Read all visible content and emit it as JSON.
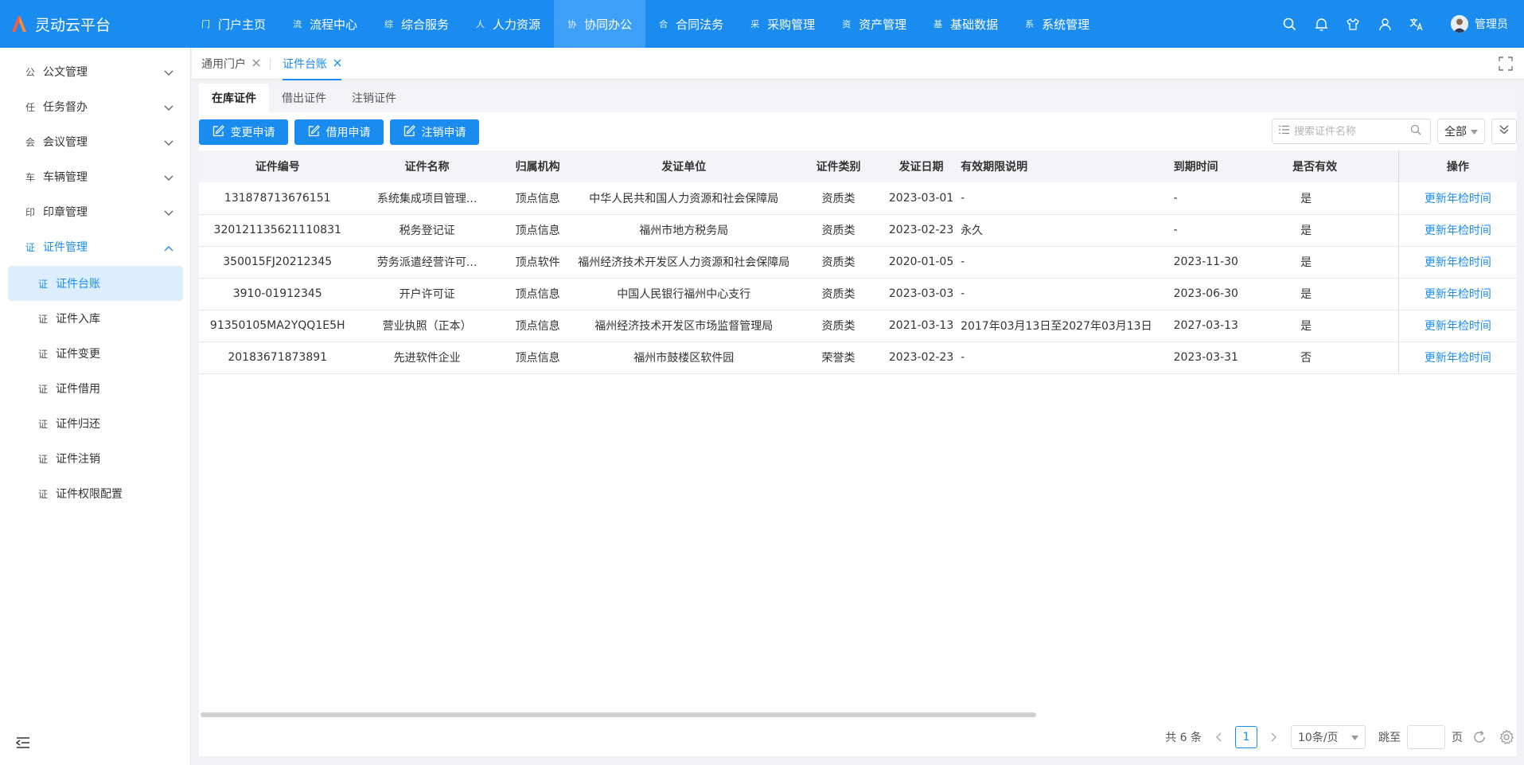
{
  "app": {
    "title": "灵动云平台"
  },
  "nav": [
    {
      "icon": "门",
      "label": "门户主页"
    },
    {
      "icon": "流",
      "label": "流程中心"
    },
    {
      "icon": "综",
      "label": "综合服务"
    },
    {
      "icon": "人",
      "label": "人力资源"
    },
    {
      "icon": "协",
      "label": "协同办公",
      "active": true
    },
    {
      "icon": "合",
      "label": "合同法务"
    },
    {
      "icon": "采",
      "label": "采购管理"
    },
    {
      "icon": "资",
      "label": "资产管理"
    },
    {
      "icon": "基",
      "label": "基础数据"
    },
    {
      "icon": "系",
      "label": "系统管理"
    }
  ],
  "user": {
    "name": "管理员"
  },
  "sidebar": {
    "groups": [
      {
        "icon": "公",
        "label": "公文管理"
      },
      {
        "icon": "任",
        "label": "任务督办"
      },
      {
        "icon": "会",
        "label": "会议管理"
      },
      {
        "icon": "车",
        "label": "车辆管理"
      },
      {
        "icon": "印",
        "label": "印章管理"
      },
      {
        "icon": "证",
        "label": "证件管理",
        "open": true
      }
    ],
    "sub_items": [
      {
        "icon": "证",
        "label": "证件台账",
        "active": true
      },
      {
        "icon": "证",
        "label": "证件入库"
      },
      {
        "icon": "证",
        "label": "证件变更"
      },
      {
        "icon": "证",
        "label": "证件借用"
      },
      {
        "icon": "证",
        "label": "证件归还"
      },
      {
        "icon": "证",
        "label": "证件注销"
      },
      {
        "icon": "证",
        "label": "证件权限配置"
      }
    ]
  },
  "page_tabs": [
    {
      "label": "通用门户"
    },
    {
      "label": "证件台账",
      "active": true
    }
  ],
  "sub_tabs": [
    {
      "label": "在库证件",
      "active": true
    },
    {
      "label": "借出证件"
    },
    {
      "label": "注销证件"
    }
  ],
  "actions": [
    {
      "label": "变更申请"
    },
    {
      "label": "借用申请"
    },
    {
      "label": "注销申请"
    }
  ],
  "search": {
    "placeholder": "搜索证件名称"
  },
  "filter": {
    "value": "全部"
  },
  "table": {
    "columns": [
      "证件编号",
      "证件名称",
      "归属机构",
      "发证单位",
      "证件类别",
      "发证日期",
      "有效期限说明",
      "到期时间",
      "是否有效",
      "操作"
    ],
    "rows": [
      [
        "131878713676151",
        "系统集成项目管理...",
        "顶点信息",
        "中华人民共和国人力资源和社会保障局",
        "资质类",
        "2023-03-01",
        "-",
        "-",
        "是",
        "更新年检时间"
      ],
      [
        "320121135621110831",
        "税务登记证",
        "顶点信息",
        "福州市地方税务局",
        "资质类",
        "2023-02-23",
        "永久",
        "-",
        "是",
        "更新年检时间"
      ],
      [
        "350015FJ20212345",
        "劳务派遣经营许可...",
        "顶点软件",
        "福州经济技术开发区人力资源和社会保障局",
        "资质类",
        "2020-01-05",
        "-",
        "2023-11-30",
        "是",
        "更新年检时间"
      ],
      [
        "3910-01912345",
        "开户许可证",
        "顶点信息",
        "中国人民银行福州中心支行",
        "资质类",
        "2023-03-03",
        "-",
        "2023-06-30",
        "是",
        "更新年检时间"
      ],
      [
        "91350105MA2YQQ1E5H",
        "营业执照（正本）",
        "顶点信息",
        "福州经济技术开发区市场监督管理局",
        "资质类",
        "2021-03-13",
        "2017年03月13日至2027年03月13日",
        "2027-03-13",
        "是",
        "更新年检时间"
      ],
      [
        "20183671873891",
        "先进软件企业",
        "顶点信息",
        "福州市鼓楼区软件园",
        "荣誉类",
        "2023-02-23",
        "-",
        "2023-03-31",
        "否",
        "更新年检时间"
      ]
    ]
  },
  "pagination": {
    "total_text": "共 6 条",
    "current_page": "1",
    "page_size": "10条/页",
    "jump_label": "跳至",
    "page_unit": "页"
  },
  "colors": {
    "primary": "#1a8cf0",
    "topbar": "#1a8cf0",
    "active_nav": "#3d9ff5",
    "sidebar_active_bg": "#ddeefe"
  }
}
